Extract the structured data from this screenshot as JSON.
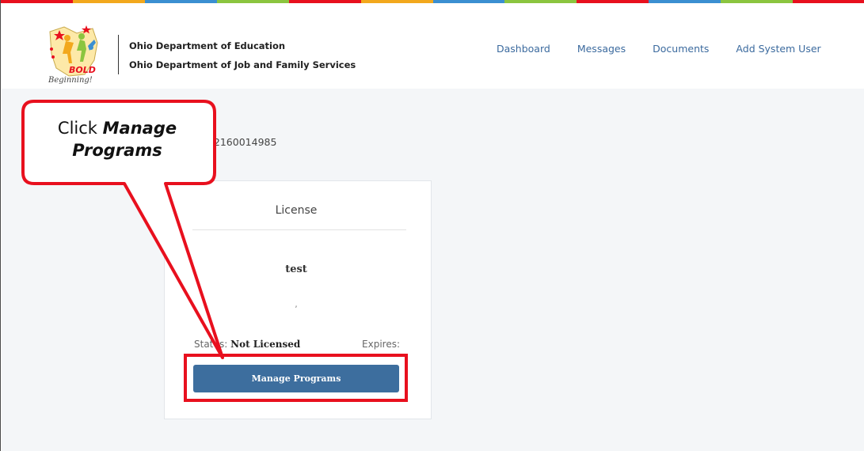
{
  "header": {
    "logo": {
      "icon": "bold-beginning-logo",
      "line1": "BOLD",
      "line2": "Beginning!"
    },
    "org_line1": "Ohio Department of Education",
    "org_line2": "Ohio Department of Job and Family Services",
    "nav": [
      {
        "label": "Dashboard"
      },
      {
        "label": "Messages"
      },
      {
        "label": "Documents"
      },
      {
        "label": "Add System User"
      }
    ]
  },
  "provider": {
    "number_text": "mber: 2160014985"
  },
  "card": {
    "title": "License",
    "program_name": "test",
    "address": ",",
    "status_label": "Status:",
    "status_value": "Not Licensed",
    "expires_label": "Expires:",
    "button_label": "Manage Programs"
  },
  "callout": {
    "prefix": "Click ",
    "emphasis": "Manage Programs"
  },
  "colors": {
    "accent": "#3d6e9e",
    "callout_red": "#e8101e",
    "stripe": [
      "#e8101e",
      "#f2a81d",
      "#3b8fd1",
      "#8bc53f",
      "#e8101e",
      "#f2a81d",
      "#3b8fd1",
      "#8bc53f",
      "#e8101e",
      "#3b8fd1",
      "#8bc53f",
      "#e8101e"
    ]
  }
}
